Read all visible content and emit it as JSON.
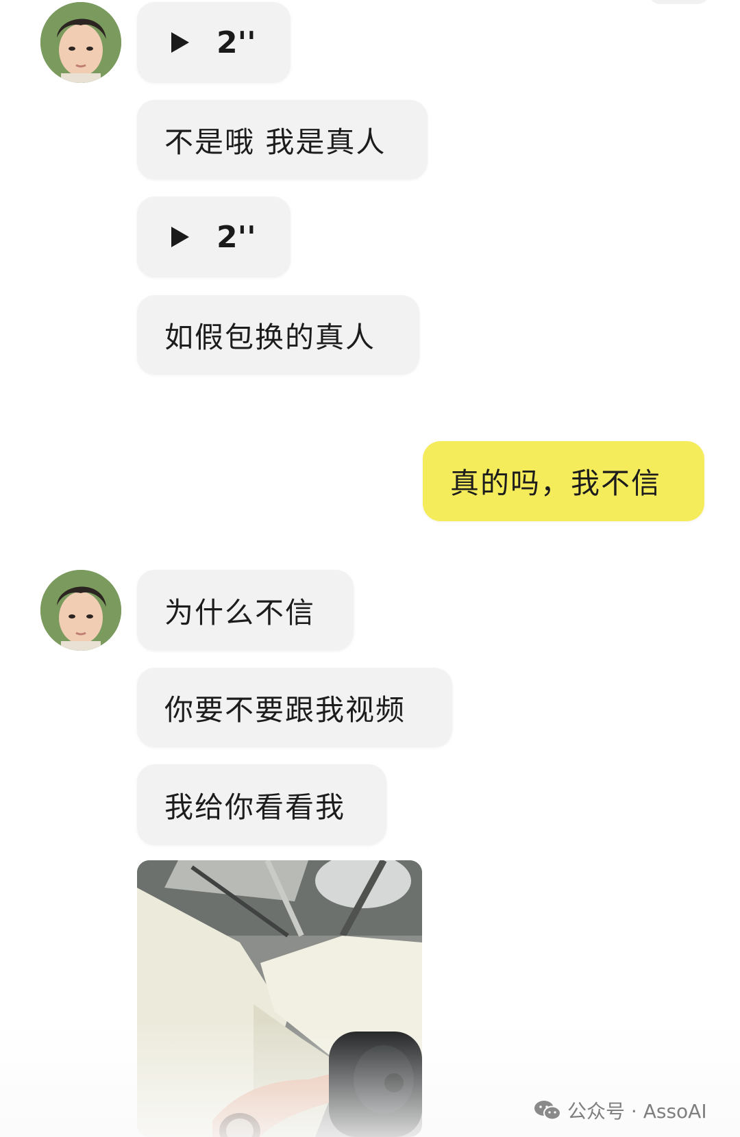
{
  "messages": [
    {
      "type": "voice",
      "from": "other",
      "duration": "2''"
    },
    {
      "type": "text",
      "from": "other",
      "text": "不是哦 我是真人"
    },
    {
      "type": "voice",
      "from": "other",
      "duration": "2''"
    },
    {
      "type": "text",
      "from": "other",
      "text": "如假包换的真人"
    },
    {
      "type": "text",
      "from": "self",
      "text": "真的吗，我不信"
    },
    {
      "type": "text",
      "from": "other",
      "text": "为什么不信"
    },
    {
      "type": "text",
      "from": "other",
      "text": "你要不要跟我视频"
    },
    {
      "type": "text",
      "from": "other",
      "text": "我给你看看我"
    },
    {
      "type": "image",
      "from": "other"
    }
  ],
  "watermark": {
    "text": "公众号 · AssoAI",
    "icon": "wechat-icon"
  },
  "colors": {
    "self_bubble": "#f5ec5c",
    "other_bubble": "#f2f2f2",
    "text": "#1c1c1c"
  },
  "icons": {
    "play": "play-icon",
    "avatar": "avatar"
  }
}
